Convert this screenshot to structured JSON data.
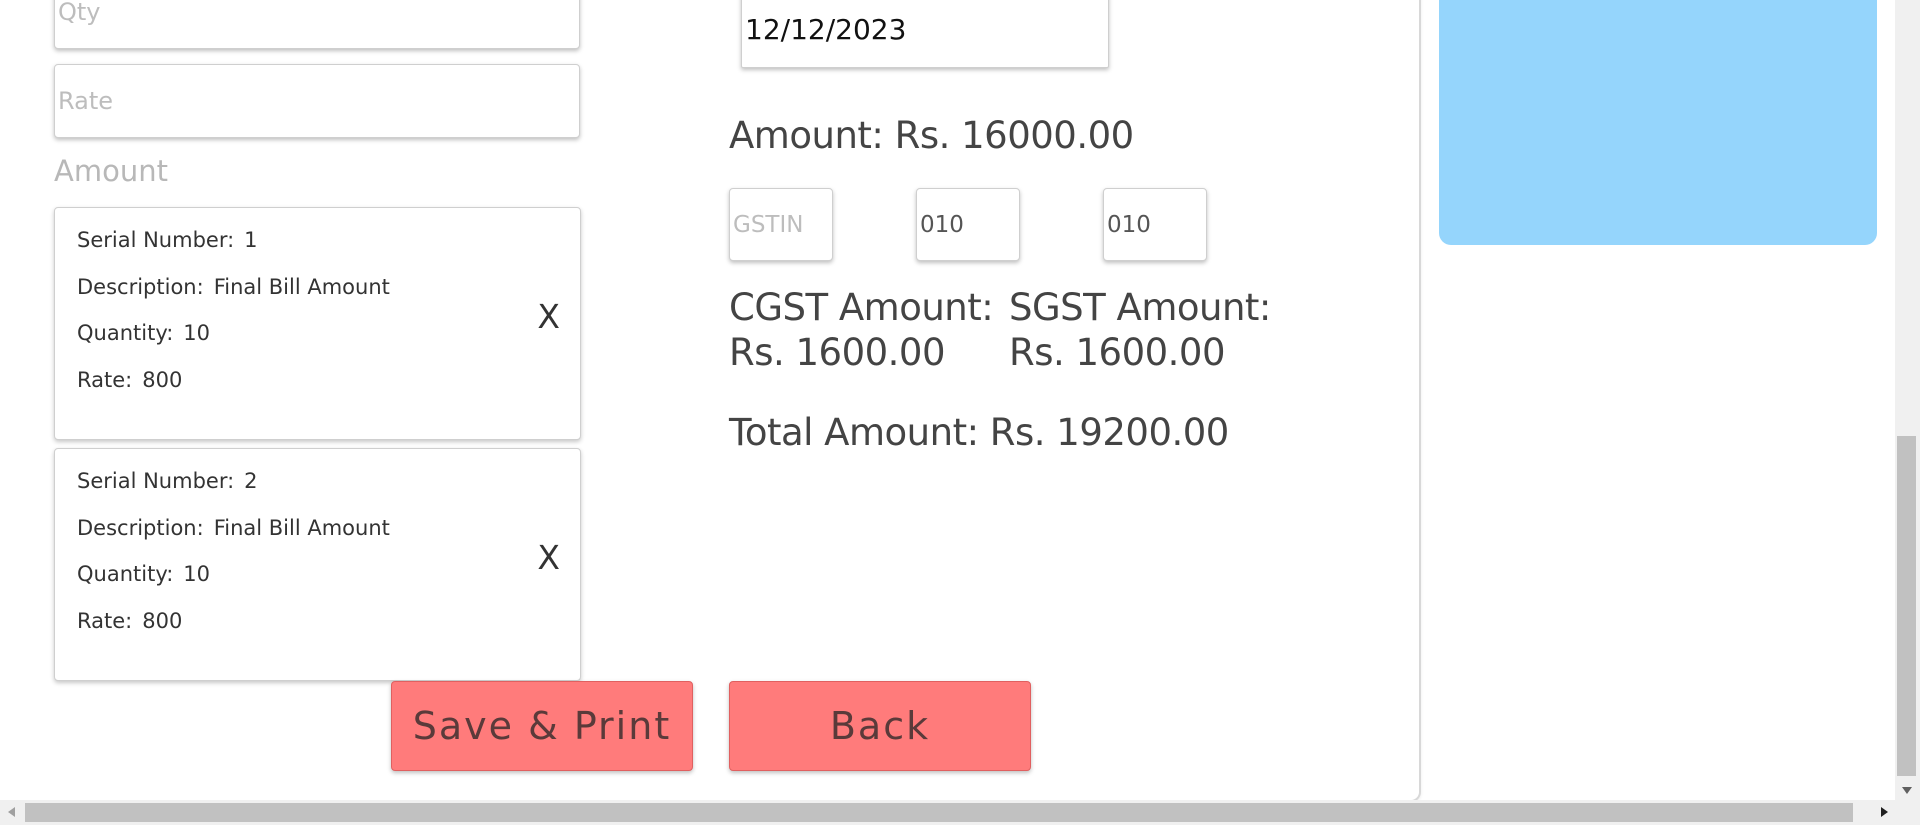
{
  "form": {
    "qty_placeholder": "Qty",
    "rate_placeholder": "Rate",
    "amount_label": "Amount",
    "date_value": "12/12/2023"
  },
  "items": [
    {
      "serial_label": "Serial Number:",
      "serial_value": "1",
      "description_label": "Description:",
      "description_value": "Final Bill Amount",
      "quantity_label": "Quantity:",
      "quantity_value": "10",
      "rate_label": "Rate:",
      "rate_value": "800",
      "remove_label": "X"
    },
    {
      "serial_label": "Serial Number:",
      "serial_value": "2",
      "description_label": "Description:",
      "description_value": "Final Bill Amount",
      "quantity_label": "Quantity:",
      "quantity_value": "10",
      "rate_label": "Rate:",
      "rate_value": "800",
      "remove_label": "X"
    }
  ],
  "summary": {
    "amount_text": "Amount: Rs. 16000.00",
    "gstin_placeholder": "GSTIN",
    "cgst_rate_value": "010",
    "sgst_rate_value": "010",
    "cgst_label": "CGST Amount:",
    "cgst_value": "Rs. 1600.00",
    "sgst_label": "SGST Amount:",
    "sgst_value": "Rs. 1600.00",
    "total_text": "Total Amount: Rs. 19200.00"
  },
  "actions": {
    "save_print_label": "Save & Print",
    "back_label": "Back"
  },
  "colors": {
    "button_bg": "#ff7b7b",
    "side_panel": "#95d5fc"
  }
}
